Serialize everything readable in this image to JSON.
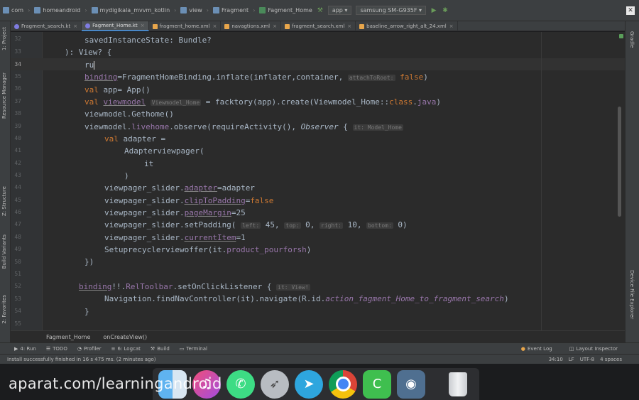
{
  "navbar": {
    "crumbs": [
      "com",
      "homeandroid",
      "mydigikala_mvvm_kotlin",
      "view",
      "Fragment",
      "Fagment_Home"
    ],
    "run_config": "app",
    "device": "samsung SM-G935F"
  },
  "tabs": [
    {
      "label": "Fragment_search.kt",
      "kind": "kt",
      "active": false
    },
    {
      "label": "Fagment_Home.kt",
      "kind": "kt",
      "active": true
    },
    {
      "label": "fragment_home.xml",
      "kind": "xml",
      "active": false
    },
    {
      "label": "navagtions.xml",
      "kind": "xml",
      "active": false
    },
    {
      "label": "fragment_search.xml",
      "kind": "xml",
      "active": false
    },
    {
      "label": "baseline_arrow_right_alt_24.xml",
      "kind": "xml",
      "active": false
    }
  ],
  "left_tools": [
    "1: Project",
    "Resource Manager",
    "Z: Structure",
    "Build Variants",
    "2: Favorites"
  ],
  "right_tools": [
    "Gradle",
    "Device File Explorer"
  ],
  "line_numbers": [
    "32",
    "33",
    "34",
    "35",
    "36",
    "37",
    "38",
    "39",
    "40",
    "41",
    "42",
    "43",
    "44",
    "45",
    "46",
    "47",
    "48",
    "49",
    "50",
    "51",
    "52",
    "53",
    "54",
    "55"
  ],
  "current_line": "34",
  "code": {
    "l32": "savedInstanceState: Bundle?",
    "l33": "): View? {",
    "l34": "ru",
    "l35_a": "binding",
    "l35_b": "=FragmentHomeBinding.inflate(inflater,container, ",
    "l35_hint": "attachToRoot:",
    "l35_c": " false",
    "l35_d": ")",
    "l36_kw": "val",
    "l36_b": " app= App()",
    "l37_kw": "val",
    "l37_var": "viewmodel",
    "l37_hint": "Viewmodel_Home",
    "l37_c": " = facktory(app).create(Viewmodel_Home::",
    "l37_kw2": "class",
    "l37_d": ".",
    "l37_java": "java",
    "l37_e": ")",
    "l38": "viewmodel.Gethome()",
    "l39_a": "viewmodel.",
    "l39_prop": "livehome",
    "l39_b": ".observe(requireActivity(), ",
    "l39_c": "Observer",
    "l39_d": " { ",
    "l39_hint": "it: Model_Home",
    "l40_kw": "val",
    "l40_b": " adapter =",
    "l41": "Adapterviewpager(",
    "l42": "it",
    "l43": ")",
    "l44_a": "viewpager_slider.",
    "l44_prop": "adapter",
    "l44_b": "=adapter",
    "l45_a": "viewpager_slider.",
    "l45_prop": "clipToPadding",
    "l45_b": "=",
    "l45_kw": "false",
    "l46_a": "viewpager_slider.",
    "l46_prop": "pageMargin",
    "l46_b": "=25",
    "l47_a": "viewpager_slider.setPadding( ",
    "l47_h1": "left:",
    "l47_v1": " 45, ",
    "l47_h2": "top:",
    "l47_v2": " 0, ",
    "l47_h3": "right:",
    "l47_v3": " 10, ",
    "l47_h4": "bottom:",
    "l47_v4": " 0)",
    "l48_a": "viewpager_slider.",
    "l48_prop": "currentItem",
    "l48_b": "=1",
    "l49_a": "Setuprecyclerviewoffer(it.",
    "l49_prop": "product_pourforsh",
    "l49_b": ")",
    "l50": "})",
    "l52_a": "binding",
    "l52_b": "!!.",
    "l52_prop": "RelToolbar",
    "l52_c": ".setOnClickListener { ",
    "l52_hint": "it: View!",
    "l53_a": "Navigation.findNavController(it).navigate(R.id.",
    "l53_prop": "action_fagment_Home_to_fragment_search",
    "l53_b": ")",
    "l54": "}"
  },
  "breadcrumb": [
    "Fagment_Home",
    "onCreateView()"
  ],
  "tool_windows": [
    {
      "label": "4: Run",
      "glyph": "▶"
    },
    {
      "label": "TODO",
      "glyph": "☰"
    },
    {
      "label": "Profiler",
      "glyph": "◔"
    },
    {
      "label": "6: Logcat",
      "glyph": "≡"
    },
    {
      "label": "Build",
      "glyph": "⚒"
    },
    {
      "label": "Terminal",
      "glyph": "▭"
    }
  ],
  "tool_windows_right": [
    {
      "label": "Event Log",
      "glyph": "●"
    },
    {
      "label": "Layout Inspector",
      "glyph": "◫"
    }
  ],
  "status": {
    "message": "Install successfully finished in 16 s 475 ms. (2 minutes ago)",
    "position": "34:10",
    "line_sep": "LF",
    "encoding": "UTF-8",
    "indent": "4 spaces"
  },
  "dock_apps": [
    "finder",
    "itunes",
    "android-messages",
    "rocket",
    "telegram",
    "chrome",
    "camtasia",
    "preview",
    "trash"
  ],
  "watermark": "aparat.com/learningandroid"
}
